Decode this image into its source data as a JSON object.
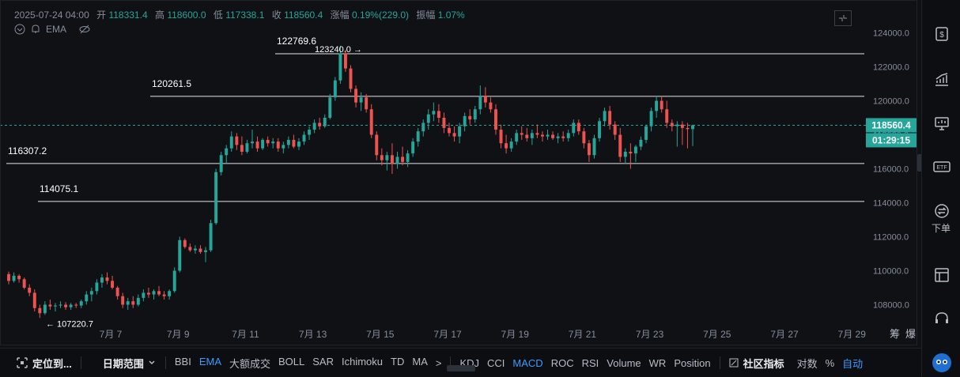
{
  "ohlc_bar": {
    "date": "2025-07-24 04:00",
    "open_label": "开",
    "open": "118331.4",
    "high_label": "高",
    "high": "118600.0",
    "low_label": "低",
    "low": "117338.1",
    "close_label": "收",
    "close": "118560.4",
    "change_label": "涨幅",
    "change": "0.19%(229.0)",
    "amplitude_label": "振幅",
    "amplitude": "1.07%"
  },
  "indicator_row": {
    "ema_label": "EMA"
  },
  "price_tags": {
    "last": "118560.4",
    "countdown": "01:29:15"
  },
  "colors": {
    "up": "#26a69a",
    "down": "#ef5350",
    "bg": "#0f1115",
    "accent": "#3b9cff",
    "grid_text": "#848e9c"
  },
  "right_toolbar": {
    "icons": [
      "dollar-doc-icon",
      "chart-trend-icon",
      "monitor-icon",
      "etf-icon",
      "order-icon",
      "layout-icon",
      "headset-icon",
      "mascot-icon"
    ],
    "order_label": "下单"
  },
  "bottom_toolbar": {
    "locate_label": "定位到...",
    "date_range_label": "日期范围",
    "main_indicators": [
      "BBI",
      "EMA",
      "大额成交",
      "BOLL",
      "SAR",
      "Ichimoku",
      "TD",
      "MA"
    ],
    "sub_indicators": [
      "KDJ",
      "CCI",
      "MACD",
      "ROC",
      "RSI",
      "Volume",
      "WR",
      "Position"
    ],
    "community_label": "社区指标",
    "log_label": "对数",
    "percent_label": "%",
    "auto_label": "自动",
    "chevron": ">"
  },
  "chart_data": {
    "type": "candlestick",
    "y_ticks": [
      108000,
      110000,
      112000,
      114000,
      116000,
      118000,
      120000,
      122000,
      124000
    ],
    "y_tick_labels": [
      "108000.0",
      "110000.0",
      "112000.0",
      "114000.0",
      "116000.0",
      "118000.0",
      "120000.0",
      "122000.0",
      "124000.0"
    ],
    "ylim": [
      106800,
      125000
    ],
    "x_tick_labels": [
      "7月 7",
      "7月 9",
      "7月 11",
      "7月 13",
      "7月 15",
      "7月 17",
      "7月 19",
      "7月 21",
      "7月 23",
      "7月 25",
      "7月 27",
      "7月 29"
    ],
    "x_range_days": [
      5.7,
      29.7
    ],
    "x_tick_days": [
      7,
      9,
      11,
      13,
      15,
      17,
      19,
      21,
      23,
      25,
      27,
      29
    ],
    "axis_extra": [
      "筹",
      "爆"
    ],
    "horizontal_lines": [
      {
        "price": 122769.6,
        "label": "122769.6"
      },
      {
        "price": 120261.5,
        "label": "120261.5"
      },
      {
        "price": 116307.2,
        "label": "116307.2"
      },
      {
        "price": 114075.1,
        "label": "114075.1"
      }
    ],
    "annotations": [
      {
        "text": "123240.0 →",
        "price": 123240.0
      },
      {
        "text": "← 107220.7",
        "price": 107220.7
      }
    ],
    "last_price": 118560.4,
    "candles": [
      [
        109800,
        109950,
        109200,
        109400
      ],
      [
        109400,
        109900,
        109300,
        109700
      ],
      [
        109700,
        109800,
        109300,
        109500
      ],
      [
        109500,
        109600,
        108900,
        109000
      ],
      [
        109000,
        109200,
        108500,
        108700
      ],
      [
        108700,
        108900,
        107600,
        107800
      ],
      [
        107800,
        108000,
        107220,
        107500
      ],
      [
        107500,
        108200,
        107400,
        108000
      ],
      [
        108000,
        108300,
        107700,
        107900
      ],
      [
        107900,
        108100,
        107600,
        107950
      ],
      [
        107950,
        108200,
        107800,
        108000
      ],
      [
        108000,
        108150,
        107700,
        107850
      ],
      [
        107850,
        108100,
        107700,
        108000
      ],
      [
        108000,
        108100,
        107800,
        107950
      ],
      [
        107950,
        108300,
        107800,
        108200
      ],
      [
        108200,
        108800,
        108000,
        108600
      ],
      [
        108600,
        109000,
        108200,
        108800
      ],
      [
        108800,
        109500,
        108600,
        109300
      ],
      [
        109300,
        109800,
        109000,
        109600
      ],
      [
        109600,
        109900,
        109200,
        109400
      ],
      [
        109400,
        109700,
        108900,
        109000
      ],
      [
        109000,
        109100,
        108300,
        108500
      ],
      [
        108500,
        108700,
        107800,
        108000
      ],
      [
        108000,
        108400,
        107700,
        108200
      ],
      [
        108200,
        108500,
        107800,
        108000
      ],
      [
        108000,
        108600,
        107900,
        108400
      ],
      [
        108400,
        108900,
        108200,
        108700
      ],
      [
        108700,
        109000,
        108400,
        108600
      ],
      [
        108600,
        108900,
        108300,
        108800
      ],
      [
        108800,
        109100,
        108500,
        108600
      ],
      [
        108600,
        108800,
        108300,
        108500
      ],
      [
        108500,
        108900,
        108300,
        108800
      ],
      [
        108800,
        110200,
        108700,
        110000
      ],
      [
        110000,
        112000,
        109900,
        111800
      ],
      [
        111800,
        111900,
        111300,
        111400
      ],
      [
        111400,
        111600,
        111100,
        111200
      ],
      [
        111200,
        111500,
        111000,
        111300
      ],
      [
        111300,
        111500,
        111000,
        111100
      ],
      [
        111100,
        111400,
        110500,
        111200
      ],
      [
        111200,
        113000,
        111100,
        112800
      ],
      [
        112800,
        116000,
        112700,
        115800
      ],
      [
        115800,
        117000,
        115600,
        116800
      ],
      [
        116800,
        117400,
        116300,
        117200
      ],
      [
        117200,
        118200,
        117000,
        117900
      ],
      [
        117900,
        118100,
        117100,
        117400
      ],
      [
        117400,
        117900,
        116800,
        117000
      ],
      [
        117000,
        117700,
        116900,
        117500
      ],
      [
        117500,
        118300,
        117200,
        117600
      ],
      [
        117600,
        117900,
        117000,
        117200
      ],
      [
        117200,
        117800,
        117100,
        117700
      ],
      [
        117700,
        117900,
        117300,
        117500
      ],
      [
        117500,
        117800,
        117200,
        117600
      ],
      [
        117600,
        117800,
        117000,
        117200
      ],
      [
        117200,
        117600,
        116900,
        117400
      ],
      [
        117400,
        117900,
        117200,
        117700
      ],
      [
        117700,
        118000,
        117200,
        117300
      ],
      [
        117300,
        117800,
        117100,
        117600
      ],
      [
        117600,
        118200,
        117400,
        118000
      ],
      [
        118000,
        118500,
        117700,
        118300
      ],
      [
        118300,
        118900,
        118100,
        118700
      ],
      [
        118700,
        119000,
        118300,
        118500
      ],
      [
        118500,
        119200,
        118400,
        119000
      ],
      [
        119000,
        120400,
        118900,
        120200
      ],
      [
        120200,
        121400,
        120000,
        121200
      ],
      [
        121200,
        123240,
        121000,
        122800
      ],
      [
        122800,
        123000,
        121700,
        121900
      ],
      [
        121900,
        122100,
        120500,
        120700
      ],
      [
        120700,
        120900,
        119600,
        119900
      ],
      [
        119900,
        120500,
        119400,
        120200
      ],
      [
        120200,
        120400,
        119300,
        119500
      ],
      [
        119500,
        119800,
        117800,
        118000
      ],
      [
        118000,
        118200,
        116500,
        116800
      ],
      [
        116800,
        117200,
        116200,
        116500
      ],
      [
        116500,
        117000,
        115900,
        116800
      ],
      [
        116800,
        117500,
        115700,
        116300
      ],
      [
        116300,
        117000,
        116000,
        116700
      ],
      [
        116700,
        117300,
        116200,
        116400
      ],
      [
        116400,
        117100,
        116100,
        116900
      ],
      [
        116900,
        117800,
        116700,
        117600
      ],
      [
        117600,
        118400,
        117300,
        118200
      ],
      [
        118200,
        118900,
        117900,
        118700
      ],
      [
        118700,
        119500,
        118300,
        119200
      ],
      [
        119200,
        119900,
        118800,
        119400
      ],
      [
        119400,
        119800,
        118700,
        119000
      ],
      [
        119000,
        119300,
        118100,
        118400
      ],
      [
        118400,
        118700,
        117900,
        118100
      ],
      [
        118100,
        118500,
        117600,
        117900
      ],
      [
        117900,
        118700,
        117500,
        118500
      ],
      [
        118500,
        119300,
        118200,
        119100
      ],
      [
        119100,
        119500,
        118600,
        118900
      ],
      [
        118900,
        119700,
        118700,
        119500
      ],
      [
        119500,
        120900,
        119200,
        120300
      ],
      [
        120300,
        120800,
        119600,
        119900
      ],
      [
        119900,
        120200,
        119300,
        119500
      ],
      [
        119500,
        119800,
        118000,
        118300
      ],
      [
        118300,
        118600,
        117200,
        117500
      ],
      [
        117500,
        118000,
        116900,
        117200
      ],
      [
        117200,
        117800,
        117000,
        117600
      ],
      [
        117600,
        118300,
        117400,
        118100
      ],
      [
        118100,
        118500,
        117700,
        118000
      ],
      [
        118000,
        118400,
        117600,
        117800
      ],
      [
        117800,
        118300,
        117400,
        118100
      ],
      [
        118100,
        118600,
        117800,
        118000
      ],
      [
        118000,
        118200,
        117600,
        117900
      ],
      [
        117900,
        118300,
        117700,
        118000
      ],
      [
        118000,
        118200,
        117700,
        117800
      ],
      [
        117800,
        118100,
        117500,
        117900
      ],
      [
        117900,
        118200,
        117600,
        117800
      ],
      [
        117800,
        118300,
        117600,
        118100
      ],
      [
        118100,
        118900,
        117900,
        118700
      ],
      [
        118700,
        118900,
        118000,
        118200
      ],
      [
        118200,
        118400,
        117200,
        117500
      ],
      [
        117500,
        117700,
        116400,
        116800
      ],
      [
        116800,
        118000,
        116600,
        117800
      ],
      [
        117800,
        119000,
        117600,
        118800
      ],
      [
        118800,
        119600,
        118500,
        119400
      ],
      [
        119400,
        119700,
        118300,
        118600
      ],
      [
        118600,
        118800,
        117700,
        118000
      ],
      [
        118000,
        118400,
        116400,
        116700
      ],
      [
        116700,
        117200,
        116300,
        117000
      ],
      [
        117000,
        117500,
        116000,
        116900
      ],
      [
        116900,
        117400,
        116400,
        117300
      ],
      [
        117300,
        117900,
        117100,
        117700
      ],
      [
        117700,
        118600,
        117500,
        118500
      ],
      [
        118500,
        119600,
        118200,
        119400
      ],
      [
        119400,
        120300,
        119000,
        120000
      ],
      [
        120000,
        120300,
        119300,
        119500
      ],
      [
        119500,
        120000,
        118400,
        118700
      ],
      [
        118700,
        118900,
        118200,
        118500
      ],
      [
        118500,
        118800,
        117300,
        118600
      ],
      [
        118600,
        118800,
        117400,
        118400
      ],
      [
        118400,
        118700,
        117200,
        118331.4
      ],
      [
        118331.4,
        118600,
        117338.1,
        118560.4
      ]
    ]
  }
}
